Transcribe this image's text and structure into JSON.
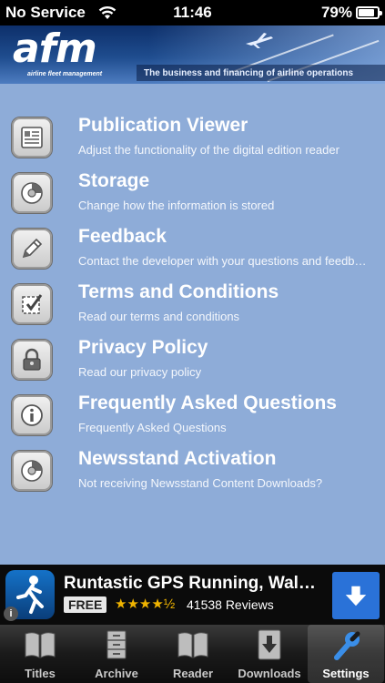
{
  "status_bar": {
    "carrier": "No Service",
    "time": "11:46",
    "battery": "79%",
    "battery_level": 0.79
  },
  "header": {
    "logo": "afm",
    "logo_subtitle": "airline fleet management",
    "tagline": "The business and financing of airline operations"
  },
  "menu": [
    {
      "title": "Publication Viewer",
      "subtitle": "Adjust the functionality of the digital edition reader",
      "icon": "publication-icon"
    },
    {
      "title": "Storage",
      "subtitle": "Change how the information is stored",
      "icon": "storage-icon"
    },
    {
      "title": "Feedback",
      "subtitle": "Contact the developer with your questions and feedb…",
      "icon": "pencil-icon"
    },
    {
      "title": "Terms and Conditions",
      "subtitle": "Read our terms and conditions",
      "icon": "checkbox-icon"
    },
    {
      "title": "Privacy Policy",
      "subtitle": "Read our privacy policy",
      "icon": "lock-icon"
    },
    {
      "title": "Frequently Asked Questions",
      "subtitle": "Frequently Asked Questions",
      "icon": "info-icon"
    },
    {
      "title": "Newsstand Activation",
      "subtitle": "Not receiving Newsstand Content Downloads?",
      "icon": "storage-icon"
    }
  ],
  "ad": {
    "title": "Runtastic GPS Running, Walkin…",
    "price": "FREE",
    "stars": "★★★★½",
    "rating": 4.5,
    "reviews": "41538 Reviews",
    "info": "i"
  },
  "tabs": [
    {
      "label": "Titles",
      "icon": "book-icon",
      "active": false
    },
    {
      "label": "Archive",
      "icon": "archive-icon",
      "active": false
    },
    {
      "label": "Reader",
      "icon": "book-icon",
      "active": false
    },
    {
      "label": "Downloads",
      "icon": "download-icon",
      "active": false
    },
    {
      "label": "Settings",
      "icon": "wrench-icon",
      "active": true
    }
  ],
  "colors": {
    "content_background": "#8eacd8",
    "header_background": "#1f4d8f",
    "download_button": "#2a72d8",
    "star": "#f0b400"
  }
}
